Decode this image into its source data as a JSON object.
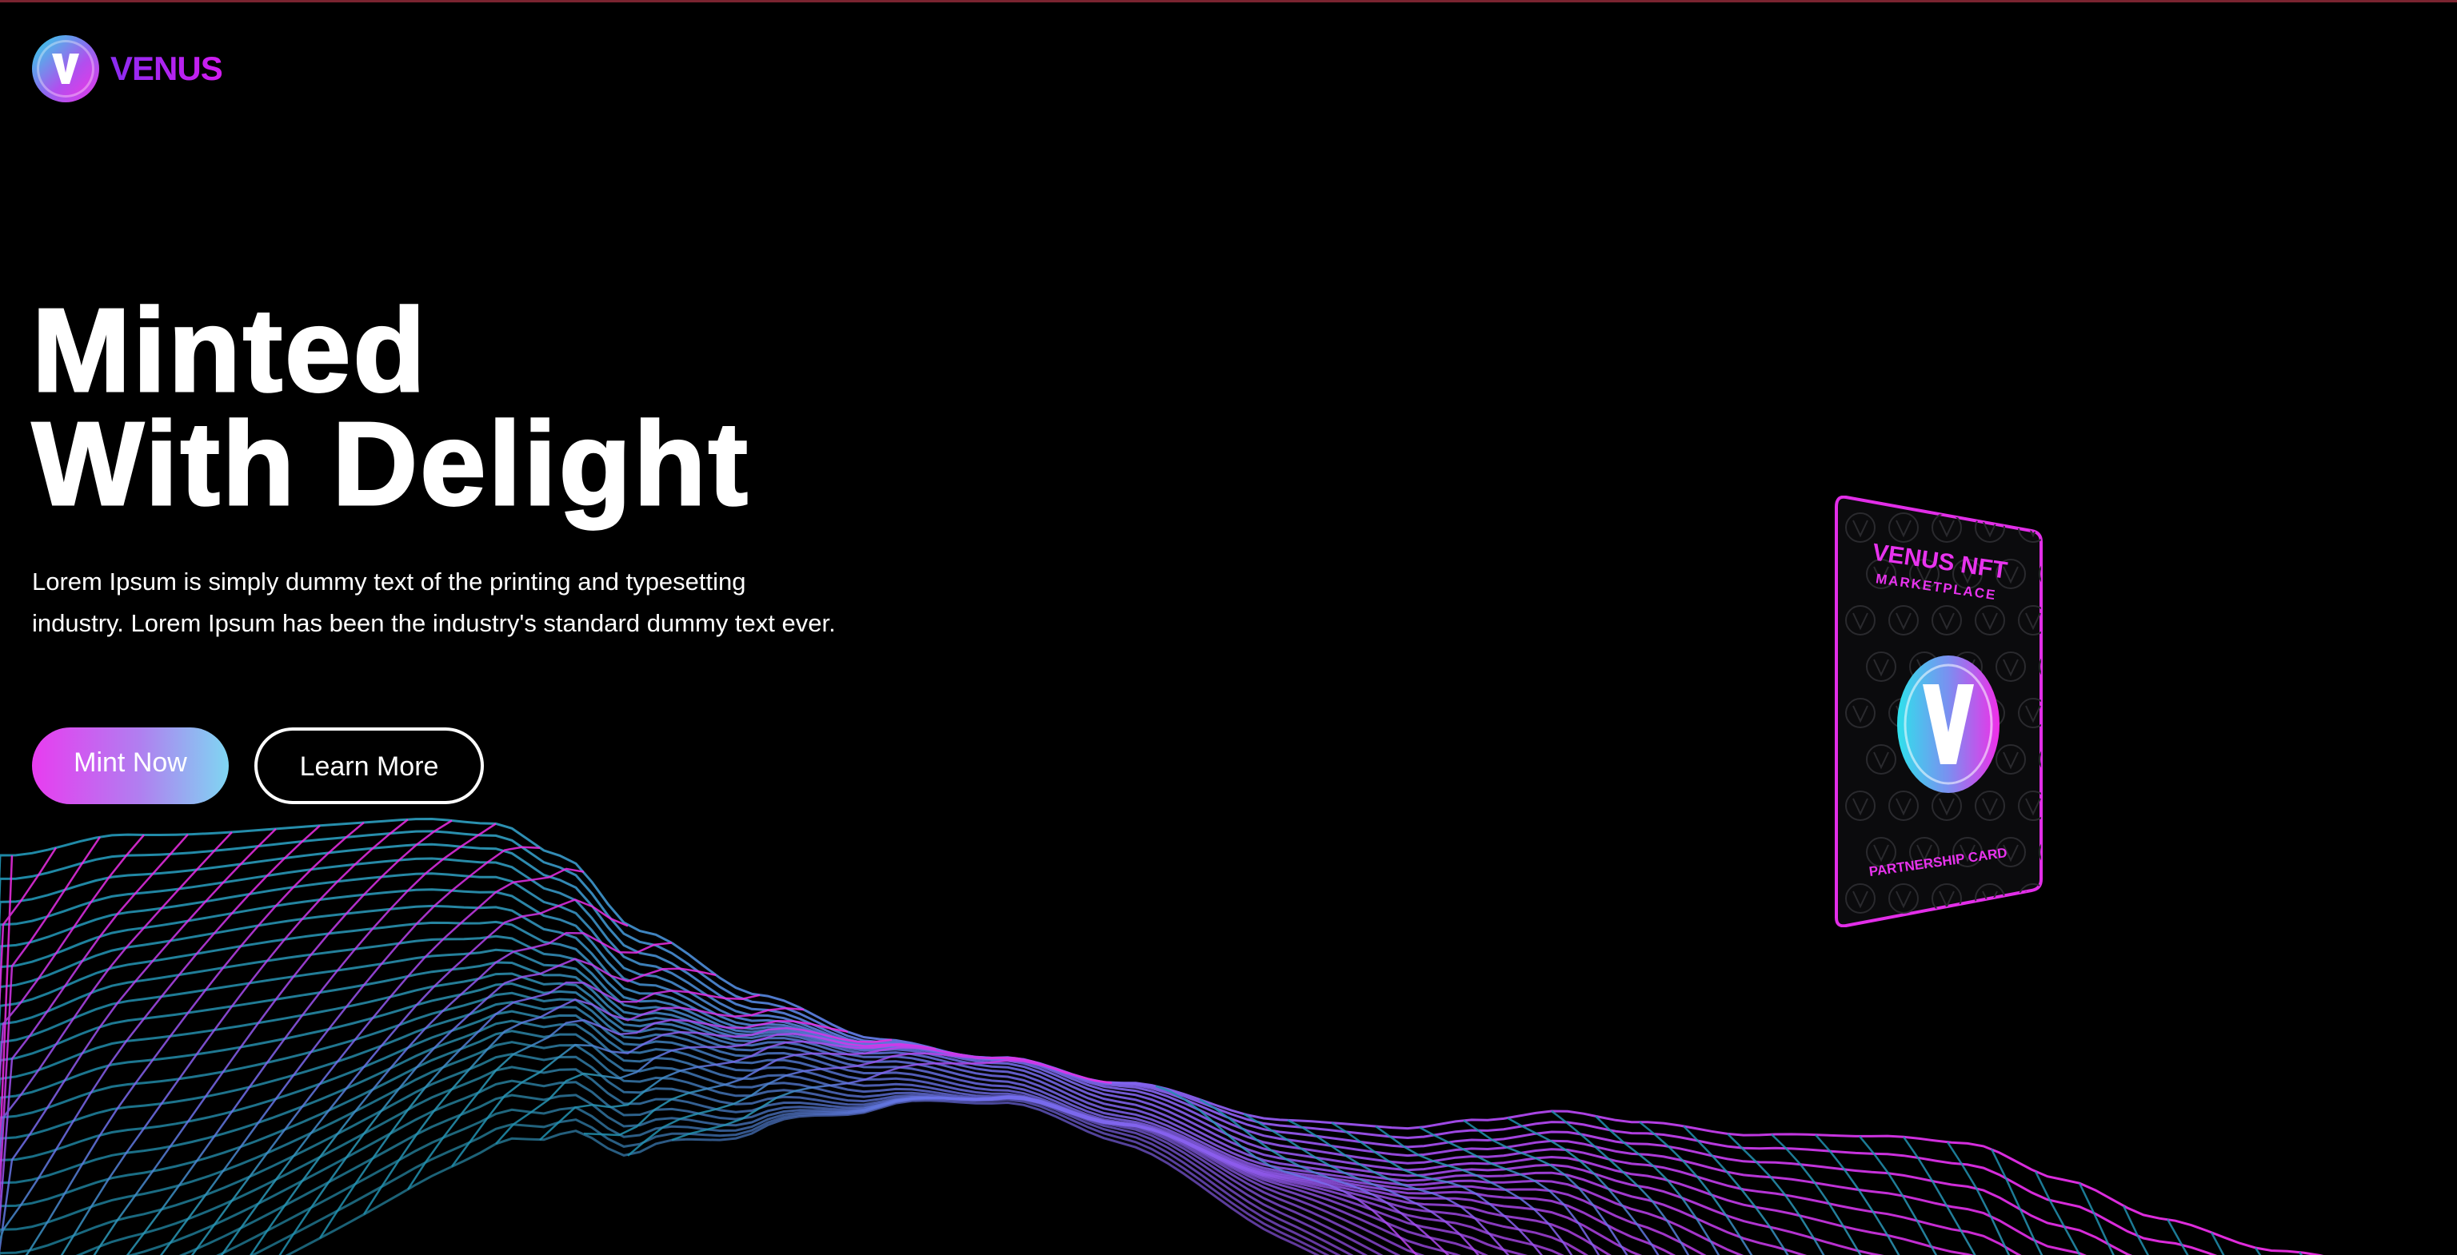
{
  "brand": {
    "name": "VENUS",
    "logo_letter": "V",
    "colors": {
      "cyan": "#2fd7e6",
      "violet": "#8a6bf0",
      "magenta": "#ef2ee8",
      "brand_text": "#b81bf0"
    }
  },
  "hero": {
    "title_line1": "Minted",
    "title_line2": "With Delight",
    "description_line1": "Lorem Ipsum is simply dummy text of the printing and typesetting",
    "description_line2": "industry. Lorem Ipsum has been the industry's standard dummy text ever."
  },
  "actions": {
    "primary_label": "Mint Now",
    "secondary_label": "Learn More"
  },
  "card": {
    "title": "VENUS NFT",
    "subtitle": "MARKETPLACE",
    "footer": "PARTNERSHIP CARD",
    "emblem_letter": "V",
    "pattern_icon": "v-coin-icon"
  },
  "decor": {
    "wave_icon": "wireframe-wave",
    "wave_colors": [
      "#2fa9c9",
      "#6d6cf0",
      "#b34cf0",
      "#ef2ee8"
    ]
  }
}
